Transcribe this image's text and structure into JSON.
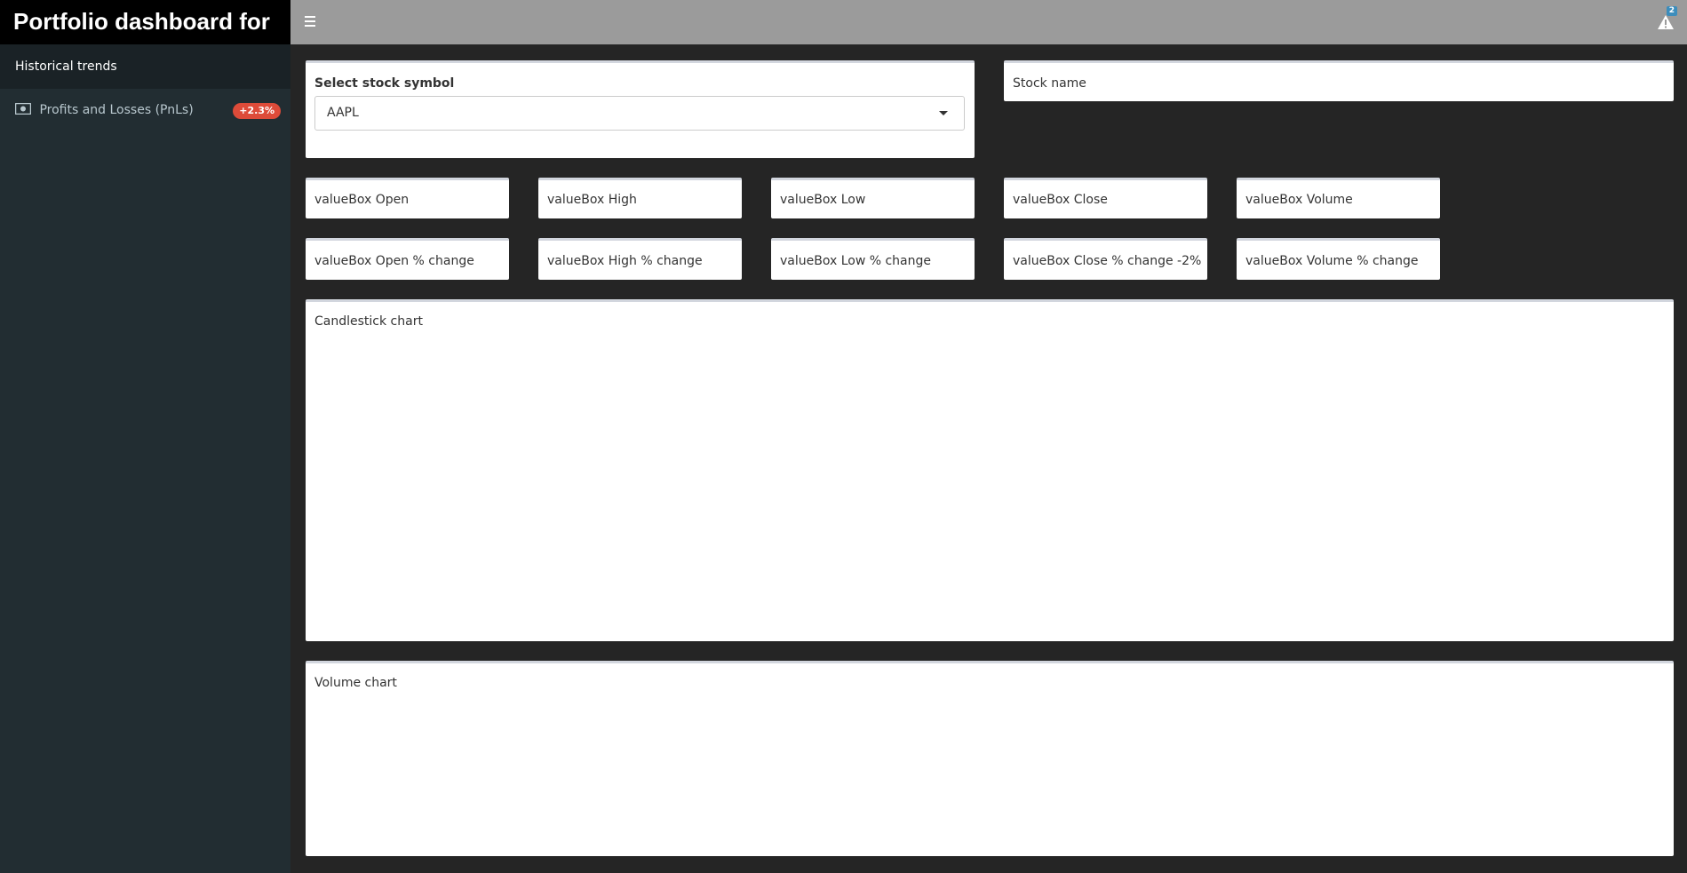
{
  "header": {
    "title": "Portfolio dashboard for",
    "notifications_count": "2",
    "icons": {
      "menu": "hamburger-icon",
      "notifications": "warning-icon"
    }
  },
  "sidebar": {
    "heading": "Historical trends",
    "items": [
      {
        "label": "Profits and Losses (PnLs)",
        "icon": "money-icon",
        "badge": "+2.3%",
        "badge_color": "#dd4b39"
      }
    ]
  },
  "main": {
    "symbol_select": {
      "label": "Select stock symbol",
      "value": "AAPL"
    },
    "stock_name": "Stock name",
    "value_boxes": [
      "valueBox Open",
      "valueBox High",
      "valueBox Low",
      "valueBox Close",
      "valueBox Volume"
    ],
    "change_boxes": [
      "valueBox Open % change",
      "valueBox High % change",
      "valueBox Low % change",
      "valueBox Close % change -2%",
      "valueBox Volume % change"
    ],
    "candlestick_chart": {
      "title": "Candlestick chart"
    },
    "volume_chart": {
      "title": "Volume chart"
    }
  },
  "colors": {
    "header_logo_bg": "#000000",
    "navbar_bg": "#9b9b9b",
    "sidebar_bg": "#222d32",
    "content_bg": "#252525",
    "badge_red": "#dd4b39"
  }
}
